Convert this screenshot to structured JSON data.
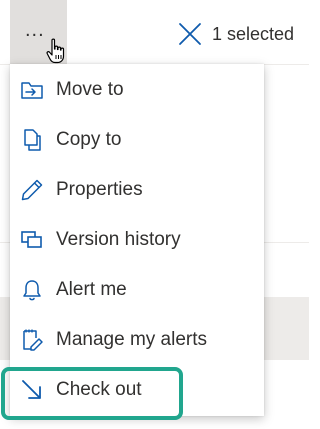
{
  "toolbar": {
    "more_label": "...",
    "selection_text": "1 selected"
  },
  "menu": {
    "items": [
      {
        "label": "Move to",
        "icon": "move-to-icon"
      },
      {
        "label": "Copy to",
        "icon": "copy-icon"
      },
      {
        "label": "Properties",
        "icon": "pencil-icon"
      },
      {
        "label": "Version history",
        "icon": "version-history-icon"
      },
      {
        "label": "Alert me",
        "icon": "bell-icon"
      },
      {
        "label": "Manage my alerts",
        "icon": "manage-alerts-icon"
      },
      {
        "label": "Check out",
        "icon": "check-out-arrow-icon"
      }
    ]
  },
  "colors": {
    "icon_blue": "#0f5bad",
    "highlight_green": "#21a68e",
    "button_hover_gray": "#e1dfdd",
    "row_selected_gray": "#edebe9",
    "text": "#323130"
  }
}
